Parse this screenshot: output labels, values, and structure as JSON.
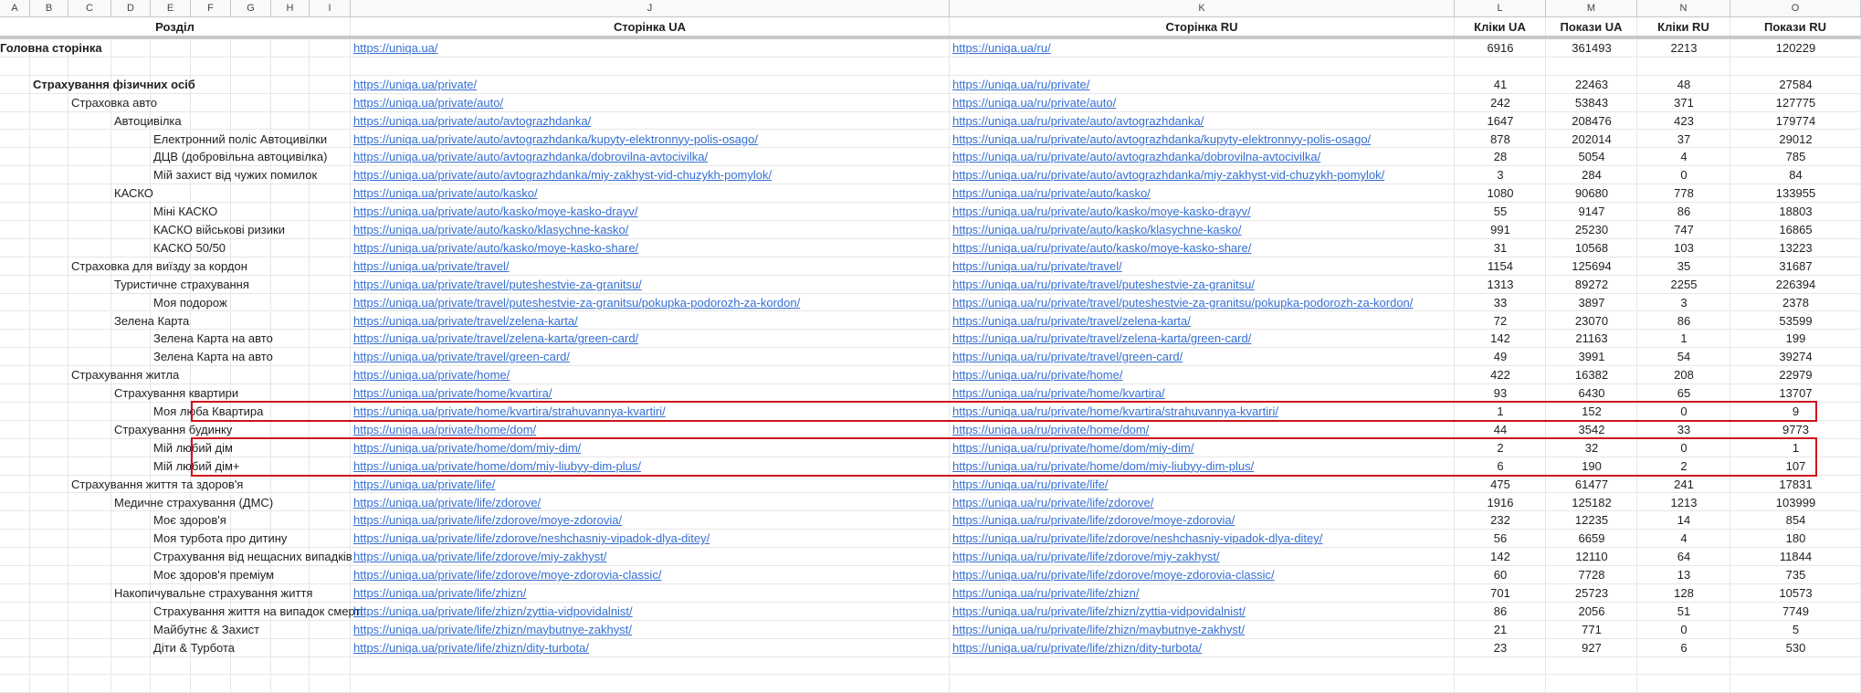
{
  "columns": [
    "A",
    "B",
    "C",
    "D",
    "E",
    "F",
    "G",
    "H",
    "I",
    "J",
    "K",
    "L",
    "M",
    "N",
    "O"
  ],
  "headers": {
    "section": "Розділ",
    "page_ua": "Сторінка UA",
    "page_ru": "Сторінка RU",
    "clicks_ua": "Кліки UA",
    "impr_ua": "Покази UA",
    "clicks_ru": "Кліки RU",
    "impr_ru": "Покази RU"
  },
  "rows": [
    {
      "level": 0,
      "bold": true,
      "name": "Головна сторінка",
      "ua": "https://uniqa.ua/",
      "ru": "https://uniqa.ua/ru/",
      "l": "6916",
      "m": "361493",
      "n": "2213",
      "o": "120229"
    },
    {
      "level": -1,
      "name": "",
      "ua": "",
      "ru": "",
      "l": "",
      "m": "",
      "n": "",
      "o": ""
    },
    {
      "level": 1,
      "bold": true,
      "name": "Страхування фізичних осіб",
      "ua": "https://uniqa.ua/private/",
      "ru": "https://uniqa.ua/ru/private/",
      "l": "41",
      "m": "22463",
      "n": "48",
      "o": "27584"
    },
    {
      "level": 2,
      "name": "Страховка авто",
      "ua": "https://uniqa.ua/private/auto/",
      "ru": "https://uniqa.ua/ru/private/auto/",
      "l": "242",
      "m": "53843",
      "n": "371",
      "o": "127775"
    },
    {
      "level": 3,
      "name": "Автоцивілка",
      "ua": "https://uniqa.ua/private/auto/avtograzhdanka/",
      "ru": "https://uniqa.ua/ru/private/auto/avtograzhdanka/",
      "l": "1647",
      "m": "208476",
      "n": "423",
      "o": "179774"
    },
    {
      "level": 4,
      "name": "Електронний поліс Автоцивілки",
      "ua": "https://uniqa.ua/private/auto/avtograzhdanka/kupyty-elektronnyy-polis-osago/",
      "ru": "https://uniqa.ua/ru/private/auto/avtograzhdanka/kupyty-elektronnyy-polis-osago/",
      "l": "878",
      "m": "202014",
      "n": "37",
      "o": "29012"
    },
    {
      "level": 4,
      "name": "ДЦВ (добровільна автоцивілка)",
      "ua": "https://uniqa.ua/private/auto/avtograzhdanka/dobrovilna-avtocivilka/",
      "ru": "https://uniqa.ua/ru/private/auto/avtograzhdanka/dobrovilna-avtocivilka/",
      "l": "28",
      "m": "5054",
      "n": "4",
      "o": "785"
    },
    {
      "level": 4,
      "name": "Мій захист від чужих помилок",
      "ua": "https://uniqa.ua/private/auto/avtograzhdanka/miy-zakhyst-vid-chuzykh-pomylok/",
      "ru": "https://uniqa.ua/ru/private/auto/avtograzhdanka/miy-zakhyst-vid-chuzykh-pomylok/",
      "l": "3",
      "m": "284",
      "n": "0",
      "o": "84"
    },
    {
      "level": 3,
      "name": "КАСКО",
      "ua": "https://uniqa.ua/private/auto/kasko/",
      "ru": "https://uniqa.ua/ru/private/auto/kasko/",
      "l": "1080",
      "m": "90680",
      "n": "778",
      "o": "133955"
    },
    {
      "level": 4,
      "name": "Міні КАСКО",
      "ua": "https://uniqa.ua/private/auto/kasko/moye-kasko-drayv/",
      "ru": "https://uniqa.ua/ru/private/auto/kasko/moye-kasko-drayv/",
      "l": "55",
      "m": "9147",
      "n": "86",
      "o": "18803"
    },
    {
      "level": 4,
      "name": "КАСКО військові ризики",
      "ua": "https://uniqa.ua/private/auto/kasko/klasychne-kasko/",
      "ru": "https://uniqa.ua/ru/private/auto/kasko/klasychne-kasko/",
      "l": "991",
      "m": "25230",
      "n": "747",
      "o": "16865"
    },
    {
      "level": 4,
      "name": "КАСКО 50/50",
      "ua": "https://uniqa.ua/private/auto/kasko/moye-kasko-share/",
      "ru": "https://uniqa.ua/ru/private/auto/kasko/moye-kasko-share/",
      "l": "31",
      "m": "10568",
      "n": "103",
      "o": "13223"
    },
    {
      "level": 2,
      "name": "Страховка для виїзду за кордон",
      "ua": "https://uniqa.ua/private/travel/",
      "ru": "https://uniqa.ua/ru/private/travel/",
      "l": "1154",
      "m": "125694",
      "n": "35",
      "o": "31687"
    },
    {
      "level": 3,
      "name": "Туристичне страхування",
      "ua": "https://uniqa.ua/private/travel/puteshestvie-za-granitsu/",
      "ru": "https://uniqa.ua/ru/private/travel/puteshestvie-za-granitsu/",
      "l": "1313",
      "m": "89272",
      "n": "2255",
      "o": "226394"
    },
    {
      "level": 4,
      "name": "Моя подорож",
      "ua": "https://uniqa.ua/private/travel/puteshestvie-za-granitsu/pokupka-podorozh-za-kordon/",
      "ru": "https://uniqa.ua/ru/private/travel/puteshestvie-za-granitsu/pokupka-podorozh-za-kordon/",
      "l": "33",
      "m": "3897",
      "n": "3",
      "o": "2378"
    },
    {
      "level": 3,
      "name": "Зелена Карта",
      "ua": "https://uniqa.ua/private/travel/zelena-karta/",
      "ru": "https://uniqa.ua/ru/private/travel/zelena-karta/",
      "l": "72",
      "m": "23070",
      "n": "86",
      "o": "53599"
    },
    {
      "level": 4,
      "name": "Зелена Карта на авто",
      "ua": "https://uniqa.ua/private/travel/zelena-karta/green-card/",
      "ru": "https://uniqa.ua/ru/private/travel/zelena-karta/green-card/",
      "l": "142",
      "m": "21163",
      "n": "1",
      "o": "199"
    },
    {
      "level": 4,
      "name": "Зелена Карта на авто",
      "ua": "https://uniqa.ua/private/travel/green-card/",
      "ru": "https://uniqa.ua/ru/private/travel/green-card/",
      "l": "49",
      "m": "3991",
      "n": "54",
      "o": "39274"
    },
    {
      "level": 2,
      "name": "Страхування житла",
      "ua": "https://uniqa.ua/private/home/",
      "ru": "https://uniqa.ua/ru/private/home/",
      "l": "422",
      "m": "16382",
      "n": "208",
      "o": "22979"
    },
    {
      "level": 3,
      "name": "Страхування квартири",
      "ua": "https://uniqa.ua/private/home/kvartira/",
      "ru": "https://uniqa.ua/ru/private/home/kvartira/",
      "l": "93",
      "m": "6430",
      "n": "65",
      "o": "13707"
    },
    {
      "level": 4,
      "name": "Моя люба Квартира",
      "ua": "https://uniqa.ua/private/home/kvartira/strahuvannya-kvartiri/",
      "ru": "https://uniqa.ua/ru/private/home/kvartira/strahuvannya-kvartiri/",
      "l": "1",
      "m": "152",
      "n": "0",
      "o": "9"
    },
    {
      "level": 3,
      "name": "Страхування будинку",
      "ua": "https://uniqa.ua/private/home/dom/",
      "ru": "https://uniqa.ua/ru/private/home/dom/",
      "l": "44",
      "m": "3542",
      "n": "33",
      "o": "9773"
    },
    {
      "level": 4,
      "name": "Мій любий дім",
      "ua": "https://uniqa.ua/private/home/dom/miy-dim/",
      "ru": "https://uniqa.ua/ru/private/home/dom/miy-dim/",
      "l": "2",
      "m": "32",
      "n": "0",
      "o": "1"
    },
    {
      "level": 4,
      "name": "Мій любий дім+",
      "ua": "https://uniqa.ua/private/home/dom/miy-liubyy-dim-plus/",
      "ru": "https://uniqa.ua/ru/private/home/dom/miy-liubyy-dim-plus/",
      "l": "6",
      "m": "190",
      "n": "2",
      "o": "107"
    },
    {
      "level": 2,
      "name": "Страхування життя та здоров'я",
      "ua": "https://uniqa.ua/private/life/",
      "ru": "https://uniqa.ua/ru/private/life/",
      "l": "475",
      "m": "61477",
      "n": "241",
      "o": "17831"
    },
    {
      "level": 3,
      "name": "Медичне страхування (ДМС)",
      "ua": "https://uniqa.ua/private/life/zdorove/",
      "ru": "https://uniqa.ua/ru/private/life/zdorove/",
      "l": "1916",
      "m": "125182",
      "n": "1213",
      "o": "103999"
    },
    {
      "level": 4,
      "name": "Моє здоров'я",
      "ua": "https://uniqa.ua/private/life/zdorove/moye-zdorovia/",
      "ru": "https://uniqa.ua/ru/private/life/zdorove/moye-zdorovia/",
      "l": "232",
      "m": "12235",
      "n": "14",
      "o": "854"
    },
    {
      "level": 4,
      "name": "Моя турбота про дитину",
      "ua": "https://uniqa.ua/private/life/zdorove/neshchasniy-vipadok-dlya-ditey/",
      "ru": "https://uniqa.ua/ru/private/life/zdorove/neshchasniy-vipadok-dlya-ditey/",
      "l": "56",
      "m": "6659",
      "n": "4",
      "o": "180"
    },
    {
      "level": 4,
      "name": "Страхування від нещасних випадків",
      "ua": "https://uniqa.ua/private/life/zdorove/miy-zakhyst/",
      "ru": "https://uniqa.ua/ru/private/life/zdorove/miy-zakhyst/",
      "l": "142",
      "m": "12110",
      "n": "64",
      "o": "11844"
    },
    {
      "level": 4,
      "name": "Моє здоров'я преміум",
      "ua": "https://uniqa.ua/private/life/zdorove/moye-zdorovia-classic/",
      "ru": "https://uniqa.ua/ru/private/life/zdorove/moye-zdorovia-classic/",
      "l": "60",
      "m": "7728",
      "n": "13",
      "o": "735"
    },
    {
      "level": 3,
      "name": "Накопичувальне страхування життя",
      "ua": "https://uniqa.ua/private/life/zhizn/",
      "ru": "https://uniqa.ua/ru/private/life/zhizn/",
      "l": "701",
      "m": "25723",
      "n": "128",
      "o": "10573"
    },
    {
      "level": 4,
      "name": "Страхування життя на випадок смерті",
      "ua": "https://uniqa.ua/private/life/zhizn/zyttia-vidpovidalnist/",
      "ru": "https://uniqa.ua/ru/private/life/zhizn/zyttia-vidpovidalnist/",
      "l": "86",
      "m": "2056",
      "n": "51",
      "o": "7749"
    },
    {
      "level": 4,
      "name": "Майбутнє & Захист",
      "ua": "https://uniqa.ua/private/life/zhizn/maybutnye-zakhyst/",
      "ru": "https://uniqa.ua/ru/private/life/zhizn/maybutnye-zakhyst/",
      "l": "21",
      "m": "771",
      "n": "0",
      "o": "5"
    },
    {
      "level": 4,
      "name": "Діти & Турбота",
      "ua": "https://uniqa.ua/private/life/zhizn/dity-turbota/",
      "ru": "https://uniqa.ua/ru/private/life/zhizn/dity-turbota/",
      "l": "23",
      "m": "927",
      "n": "6",
      "o": "530"
    }
  ]
}
